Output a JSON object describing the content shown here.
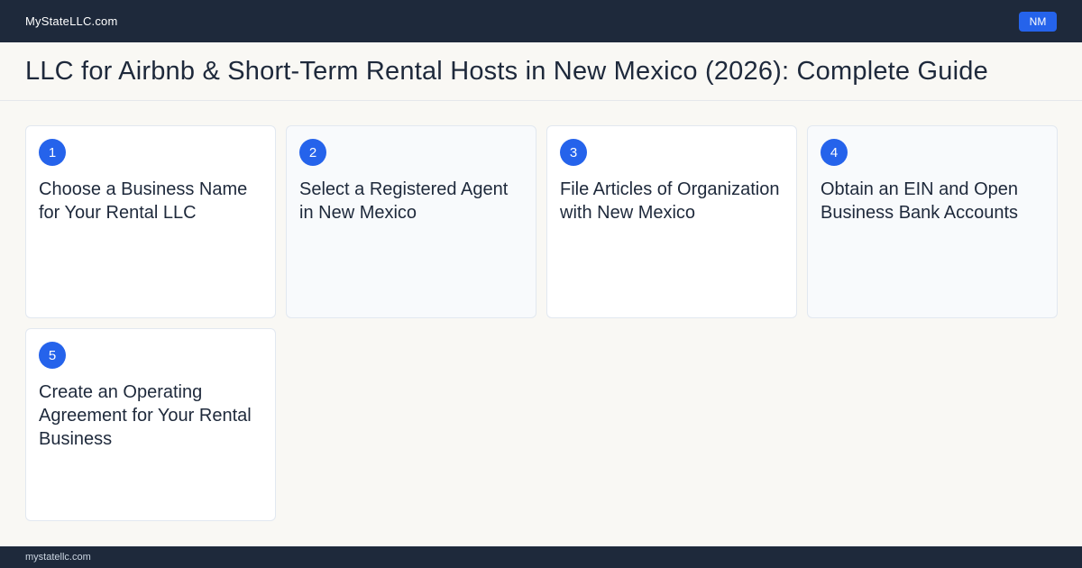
{
  "header": {
    "site_name": "MyStateLLC.com",
    "state_badge": "NM"
  },
  "page": {
    "title": "LLC for Airbnb & Short-Term Rental Hosts in New Mexico (2026): Complete Guide"
  },
  "steps": [
    {
      "number": "1",
      "title": "Choose a Business Name for Your Rental LLC"
    },
    {
      "number": "2",
      "title": "Select a Registered Agent in New Mexico"
    },
    {
      "number": "3",
      "title": "File Articles of Organization with New Mexico"
    },
    {
      "number": "4",
      "title": "Obtain an EIN and Open Business Bank Accounts"
    },
    {
      "number": "5",
      "title": "Create an Operating Agreement for Your Rental Business"
    }
  ],
  "footer": {
    "url": "mystatellc.com"
  },
  "colors": {
    "dark": "#1e293b",
    "accent": "#2563eb",
    "background": "#f9f8f4"
  }
}
